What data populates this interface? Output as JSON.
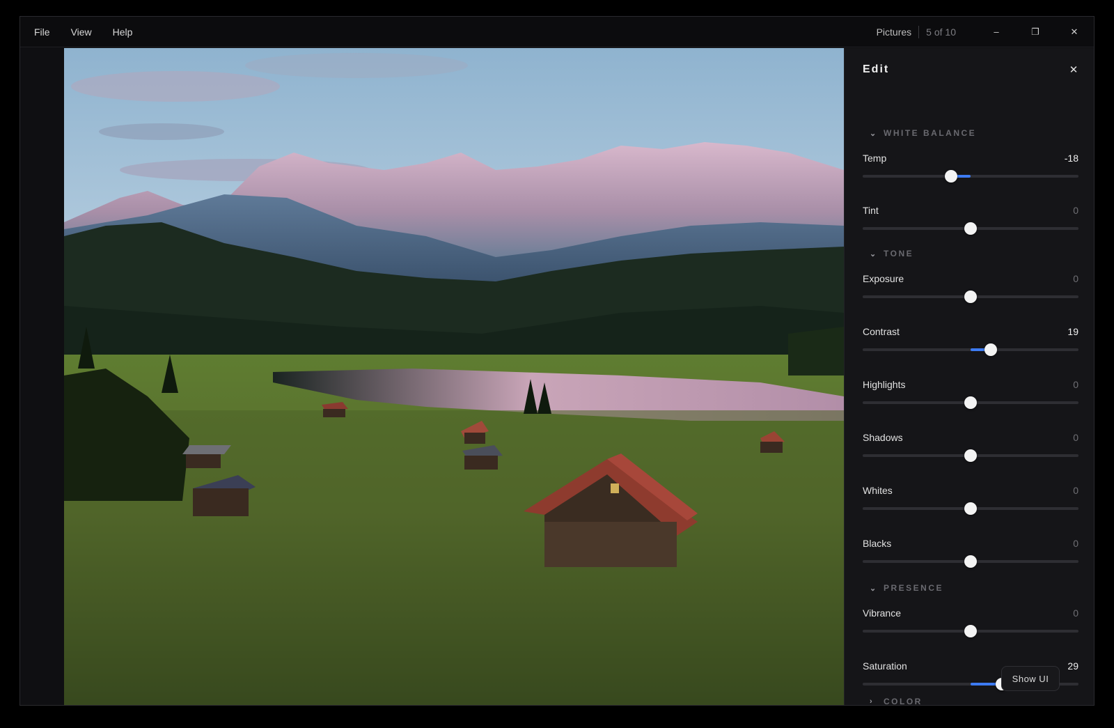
{
  "menu": [
    "File",
    "View",
    "Help"
  ],
  "titlebar": {
    "app_name": "Pictures",
    "counter": "5 of 10",
    "minimize_icon": "–",
    "maximize_icon": "❐",
    "close_icon": "✕"
  },
  "panel": {
    "title": "Edit",
    "close_icon": "✕",
    "sections": {
      "white_balance": "WHITE BALANCE",
      "tone": "TONE",
      "presence": "PRESENCE",
      "color": "COLOR"
    },
    "sliders": {
      "temp": {
        "label": "Temp",
        "value": "-18",
        "level": -18
      },
      "tint": {
        "label": "Tint",
        "value": "0",
        "level": 0
      },
      "exposure": {
        "label": "Exposure",
        "value": "0",
        "level": 0
      },
      "contrast": {
        "label": "Contrast",
        "value": "19",
        "level": 19
      },
      "highlights": {
        "label": "Highlights",
        "value": "0",
        "level": 0
      },
      "shadows": {
        "label": "Shadows",
        "value": "0",
        "level": 0
      },
      "whites": {
        "label": "Whites",
        "value": "0",
        "level": 0
      },
      "blacks": {
        "label": "Blacks",
        "value": "0",
        "level": 0
      },
      "vibrance": {
        "label": "Vibrance",
        "value": "0",
        "level": 0
      },
      "saturation": {
        "label": "Saturation",
        "value": "29",
        "level": 29
      }
    },
    "slider_range": [
      -100,
      100
    ]
  },
  "show_ui_button": "Show UI",
  "colors": {
    "accent": "#3d7bf2",
    "panel_bg": "#151518",
    "window_bg": "#0e0e10"
  }
}
